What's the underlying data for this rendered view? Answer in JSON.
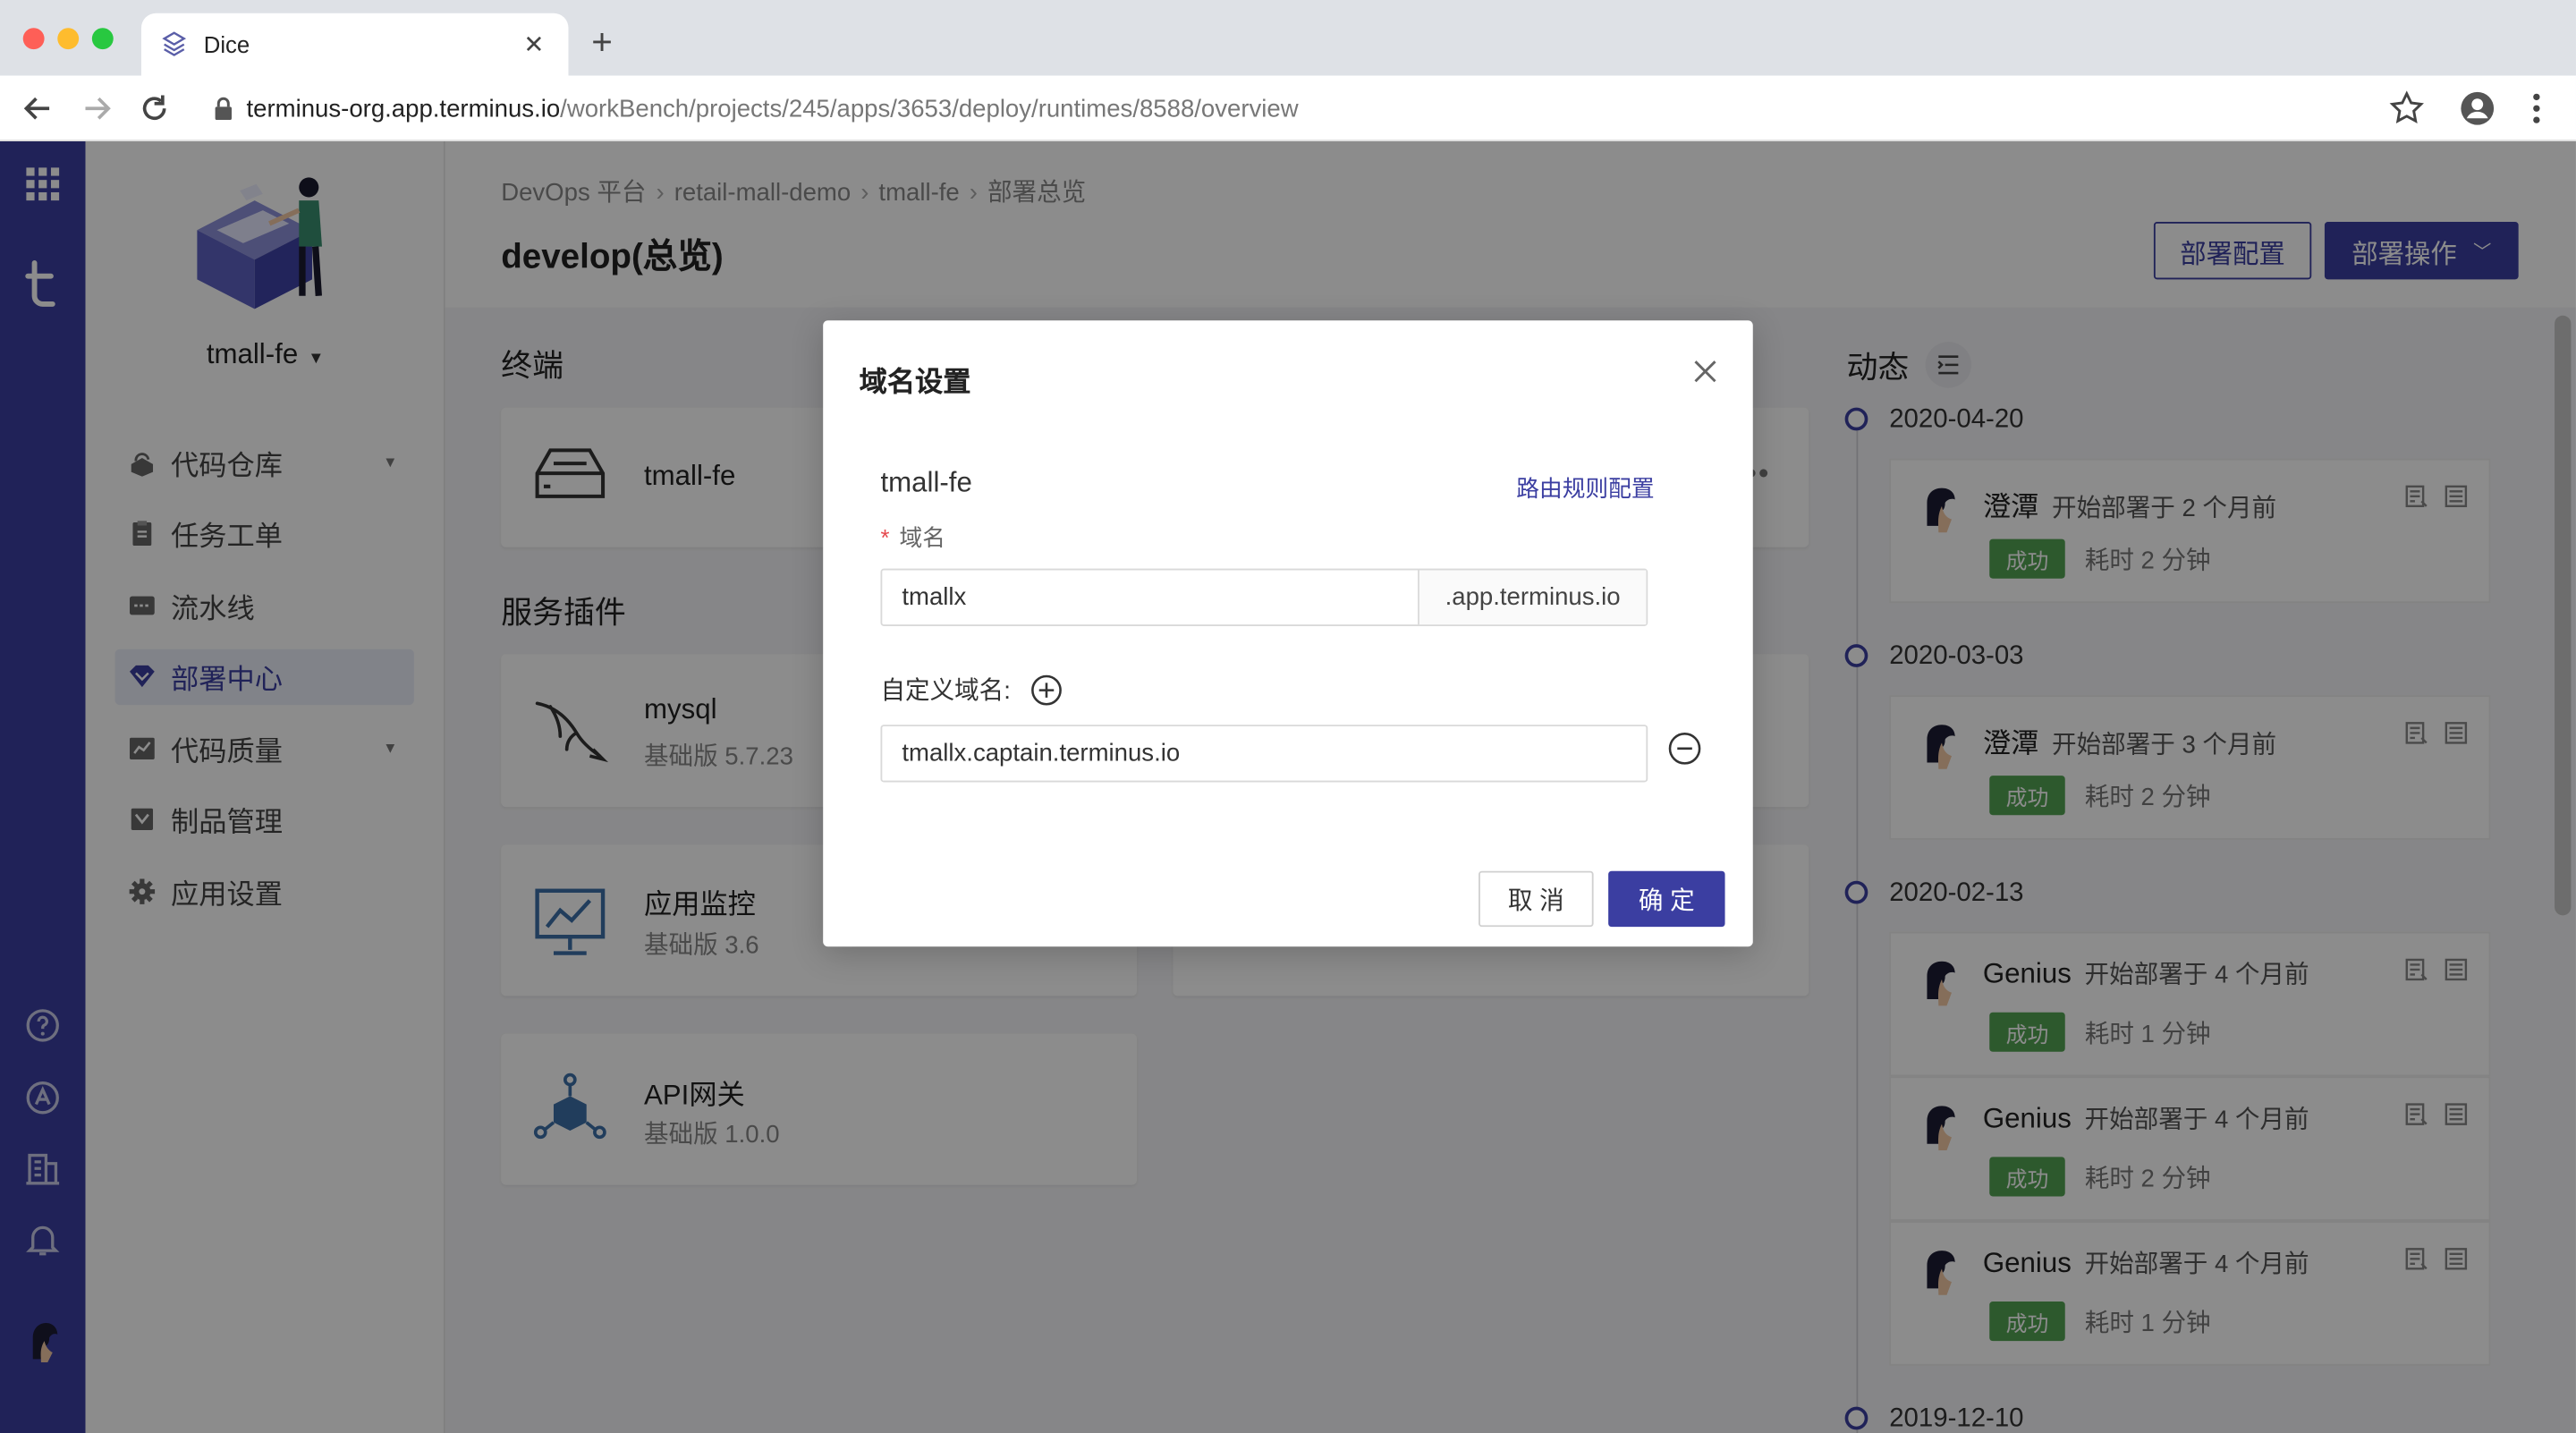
{
  "browser": {
    "tab_title": "Dice",
    "url_host": "terminus-org.app.terminus.io",
    "url_path": "/workBench/projects/245/apps/3653/deploy/runtimes/8588/overview"
  },
  "sidebar": {
    "project": "tmall-fe",
    "items": [
      {
        "label": "代码仓库"
      },
      {
        "label": "任务工单"
      },
      {
        "label": "流水线"
      },
      {
        "label": "部署中心"
      },
      {
        "label": "代码质量"
      },
      {
        "label": "制品管理"
      },
      {
        "label": "应用设置"
      }
    ]
  },
  "header": {
    "breadcrumb": [
      "DevOps 平台",
      "retail-mall-demo",
      "tmall-fe",
      "部署总览"
    ],
    "title": "develop(总览)",
    "deploy_config": "部署配置",
    "deploy_ops": "部署操作"
  },
  "sections": {
    "terminal": "终端",
    "plugins": "服务插件"
  },
  "terminal_card": {
    "name": "tmall-fe"
  },
  "plugins": [
    {
      "name": "mysql",
      "version": "基础版 5.7.23"
    },
    {
      "name": "应用监控",
      "version": "基础版 3.6"
    },
    {
      "name": "API网关",
      "version": "基础版 1.0.0"
    }
  ],
  "timeline": {
    "title": "动态",
    "dates": [
      "2020-04-20",
      "2020-03-03",
      "2020-02-13",
      "2019-12-10"
    ],
    "entries": [
      {
        "user": "澄潭",
        "action": "开始部署于 2 个月前",
        "status": "成功",
        "duration": "耗时 2 分钟"
      },
      {
        "user": "澄潭",
        "action": "开始部署于 3 个月前",
        "status": "成功",
        "duration": "耗时 2 分钟"
      },
      {
        "user": "Genius",
        "action": "开始部署于 4 个月前",
        "status": "成功",
        "duration": "耗时 1 分钟"
      },
      {
        "user": "Genius",
        "action": "开始部署于 4 个月前",
        "status": "成功",
        "duration": "耗时 2 分钟"
      },
      {
        "user": "Genius",
        "action": "开始部署于 4 个月前",
        "status": "成功",
        "duration": "耗时 1 分钟"
      }
    ]
  },
  "modal": {
    "title": "域名设置",
    "app": "tmall-fe",
    "route_link": "路由规则配置",
    "domain_label": "域名",
    "domain_value": "tmallx",
    "domain_suffix": ".app.terminus.io",
    "custom_label": "自定义域名:",
    "custom_value": "tmallx.captain.terminus.io",
    "cancel": "取 消",
    "ok": "确 定"
  },
  "colors": {
    "primary": "#3b3ea1",
    "success": "#52a253",
    "required": "#e5484d"
  }
}
